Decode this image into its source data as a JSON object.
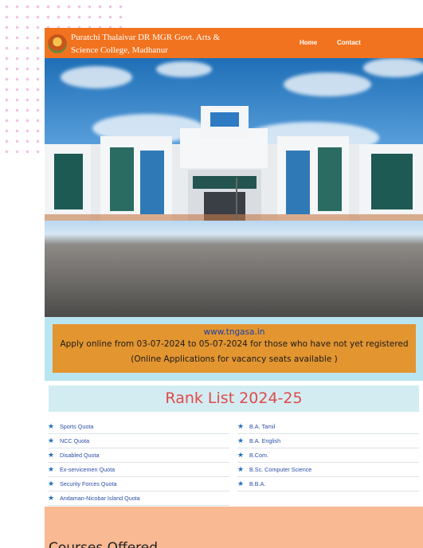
{
  "header": {
    "college_name_line1": "Puratchi Thalaivar DR MGR Govt. Arts &",
    "college_name_line2": "Science College, Madhanur",
    "nav": [
      {
        "label": "Home"
      },
      {
        "label": "Contact"
      }
    ]
  },
  "notice": {
    "url": "www.tngasa.in",
    "line1": "Apply online from 03-07-2024 to 05-07-2024 for those who have not yet registered",
    "line2": "(Online Applications for vacancy seats available )"
  },
  "rank_list": {
    "title": "Rank List 2024-25",
    "quota_items": [
      "Sports Quota",
      "NCC Quota",
      "Disabled Quota",
      "Ex-servicemen Quota",
      "Security Forces Quota",
      "Andaman-Nicobar Island Quota"
    ],
    "course_items": [
      "B.A. Tamil",
      "B.A. English",
      "B.Com.",
      "B.Sc. Computer Science",
      "B.B.A."
    ]
  },
  "courses": {
    "title": "Courses Offered"
  },
  "colors": {
    "navbar": "#f2731f",
    "notice_bg": "#e39530",
    "notice_area": "#b9e5f0",
    "rank_title": "#e04a4a",
    "link": "#2b4ea8",
    "courses_bg": "#f8b993"
  },
  "icons": [
    "college-logo",
    "star-icon"
  ]
}
